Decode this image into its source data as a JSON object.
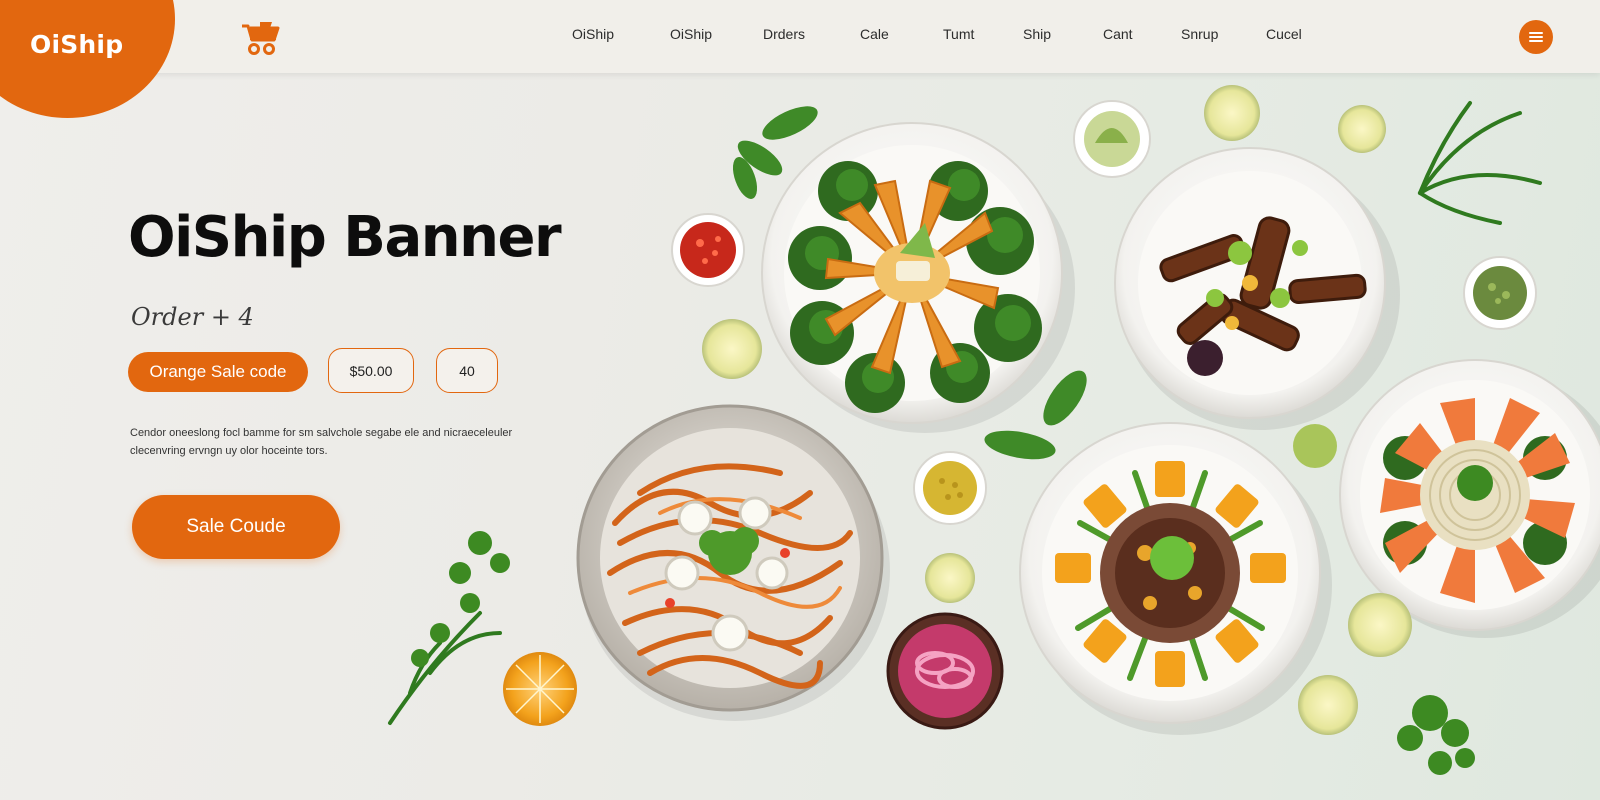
{
  "header": {
    "logo_text": "OiShip",
    "logo_icon": "cart-icon",
    "nav": [
      "OiShip",
      "OiShip",
      "Drders",
      "Cale",
      "Tumt",
      "Ship",
      "Cant",
      "Snrup",
      "Cucel"
    ],
    "user_icon": "menu-icon"
  },
  "hero": {
    "title": "OiShip Banner",
    "subtitle": "Order + 4",
    "chips": {
      "primary": "Orange Sale code",
      "price": "$50.00",
      "count": "40"
    },
    "description": "Cendor oneeslong focl bamme for sm salvchole segabe ele and nicraeceleuler clecenvring ervngn uy olor hoceinte tors.",
    "cta": "Sale Coude"
  },
  "colors": {
    "accent": "#e2670f",
    "background": "#eceae6",
    "header_bg": "#f1efea"
  }
}
